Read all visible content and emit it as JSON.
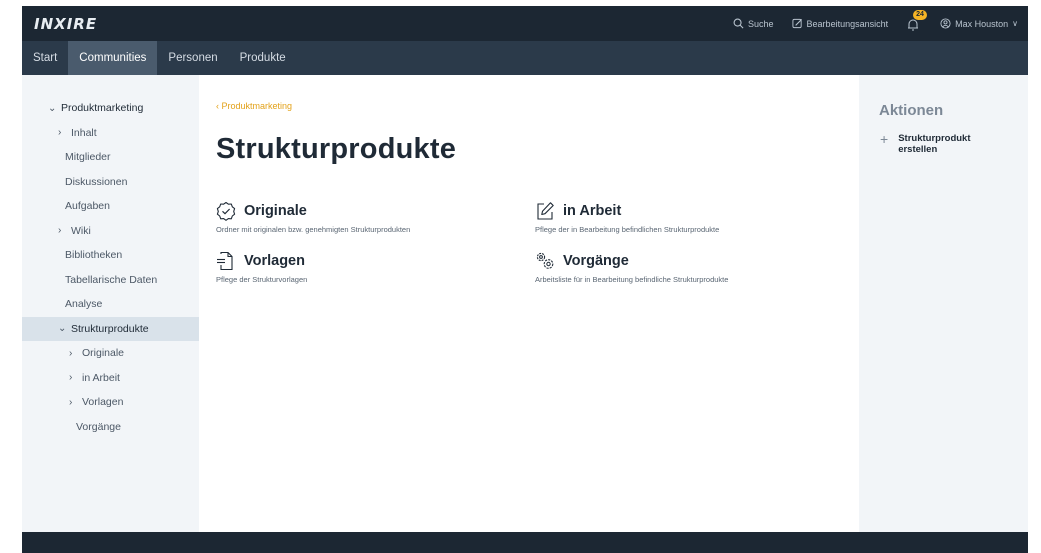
{
  "app": {
    "logo_text": "INXIRE"
  },
  "topbar": {
    "search_label": "Suche",
    "edit_view_label": "Bearbeitungsansicht",
    "notification_count": "24",
    "user_name": "Max Houston"
  },
  "nav": {
    "items": [
      {
        "label": "Start",
        "active": false
      },
      {
        "label": "Communities",
        "active": true
      },
      {
        "label": "Personen",
        "active": false
      },
      {
        "label": "Produkte",
        "active": false
      }
    ]
  },
  "sidebar": {
    "items": [
      {
        "label": "Produktmarketing",
        "chevron": "expanded",
        "level": 0
      },
      {
        "label": "Inhalt",
        "chevron": "collapsed",
        "level": 1
      },
      {
        "label": "Mitglieder",
        "chevron": "none",
        "level": 1
      },
      {
        "label": "Diskussionen",
        "chevron": "none",
        "level": 1
      },
      {
        "label": "Aufgaben",
        "chevron": "none",
        "level": 1
      },
      {
        "label": "Wiki",
        "chevron": "collapsed",
        "level": 1
      },
      {
        "label": "Bibliotheken",
        "chevron": "none",
        "level": 1
      },
      {
        "label": "Tabellarische Daten",
        "chevron": "none",
        "level": 1
      },
      {
        "label": "Analyse",
        "chevron": "none",
        "level": 1
      },
      {
        "label": "Strukturprodukte",
        "chevron": "expanded",
        "level": 1,
        "selected": true
      },
      {
        "label": "Originale",
        "chevron": "collapsed",
        "level": 2
      },
      {
        "label": "in Arbeit",
        "chevron": "collapsed",
        "level": 2
      },
      {
        "label": "Vorlagen",
        "chevron": "collapsed",
        "level": 2
      },
      {
        "label": "Vorgänge",
        "chevron": "none",
        "level": 2
      }
    ]
  },
  "main": {
    "breadcrumb": "‹ Produktmarketing",
    "title": "Strukturprodukte",
    "cards": [
      {
        "title": "Originale",
        "description": "Ordner mit originalen bzw. genehmigten Strukturprodukten",
        "icon": "check-badge-icon"
      },
      {
        "title": "in Arbeit",
        "description": "Pflege der in Bearbeitung befindlichen Strukturprodukte",
        "icon": "edit-icon"
      },
      {
        "title": "Vorlagen",
        "description": "Pflege der Strukturvorlagen",
        "icon": "template-icon"
      },
      {
        "title": "Vorgänge",
        "description": "Arbeitsliste für in Bearbeitung befindliche Strukturprodukte",
        "icon": "gears-icon"
      }
    ]
  },
  "actions": {
    "title": "Aktionen",
    "items": [
      {
        "label_line1": "Strukturprodukt",
        "label_line2": "erstellen",
        "icon": "plus-icon"
      }
    ]
  },
  "colors": {
    "topbar": "#1c2733",
    "navbar": "#2b3a4a",
    "nav_active": "#4a5b6d",
    "panel_bg": "#f2f5f8",
    "accent": "#e3a21a",
    "badge": "#f5b325"
  }
}
